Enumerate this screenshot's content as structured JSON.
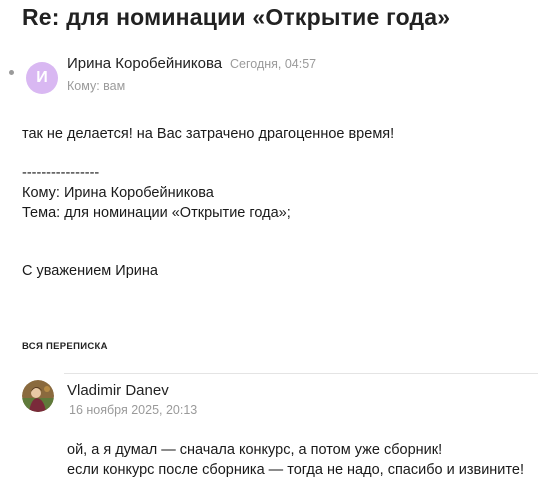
{
  "message": {
    "subject": "Re: для номинации «Открытие года»",
    "sender": {
      "avatar_letter": "И",
      "name": "Ирина Коробейникова",
      "time": "Сегодня, 04:57"
    },
    "recipient": "Кому: вам",
    "body": {
      "line1": "так не делается! на Вас затрачено драгоценное время!",
      "separator": "----------------",
      "quoted_to": "Кому: Ирина Коробейникова",
      "quoted_subject": "Тема: для номинации «Открытие года»;",
      "signature": "С уважением Ирина"
    }
  },
  "thread": {
    "section_label": "ВСЯ ПЕРЕПИСКА",
    "items": [
      {
        "sender": "Vladimir Danev",
        "date": "16 ноября 2025, 20:13",
        "line1": "ой, а я думал — сначала конкурс, а потом уже сборник!",
        "line2": "если конкурс после сборника — тогда не надо, спасибо и извините!"
      }
    ]
  },
  "colors": {
    "avatar_bg": "#d9b8f2",
    "muted_text": "#9a9a9a"
  }
}
